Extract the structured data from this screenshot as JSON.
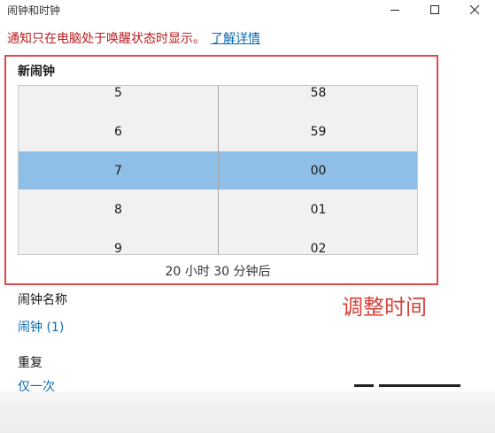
{
  "window": {
    "title": "闹钟和时钟"
  },
  "notice": {
    "warning": "通知只在电脑处于唤醒状态时显示。",
    "link": "了解详情"
  },
  "alarm": {
    "section_title": "新闹钟",
    "hours": [
      "5",
      "6",
      "7",
      "8",
      "9"
    ],
    "minutes": [
      "58",
      "59",
      "00",
      "01",
      "02"
    ],
    "selected_hour": "7",
    "selected_minute": "00",
    "countdown": "20 小时 30 分钟后"
  },
  "annotation": "调整时间",
  "name_field": {
    "label": "闹钟名称",
    "value": "闹钟 (1)"
  },
  "repeat_field": {
    "label": "重复",
    "value": "仅一次"
  },
  "colors": {
    "selection": "#8fbfe6",
    "link": "#0a6bb5",
    "warning": "#b81d1d",
    "annotation_red": "#e04a4a"
  },
  "icons": [
    "minimize-icon",
    "maximize-icon",
    "close-icon"
  ]
}
